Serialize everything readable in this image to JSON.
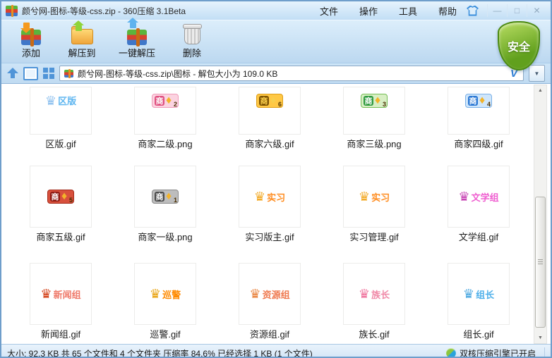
{
  "window": {
    "title": "颜兮网-图标-等级-css.zip - 360压缩 3.1Beta",
    "controls": {
      "minimize": "—",
      "maximize": "□",
      "close": "✕"
    }
  },
  "menu": {
    "items": [
      "文件",
      "操作",
      "工具",
      "帮助"
    ]
  },
  "toolbar": {
    "add_label": "添加",
    "extract_to_label": "解压到",
    "one_click_extract_label": "一键解压",
    "delete_label": "删除",
    "security_label": "安全"
  },
  "addressbar": {
    "path": "颜兮网-图标-等级-css.zip\\图标 - 解包大小为 109.0 KB",
    "v_mark": "V"
  },
  "glyphs": {
    "crown": "♛",
    "gem": "♦",
    "scroll_up": "▲",
    "scroll_down": "▼",
    "dropdown": "▼"
  },
  "files": [
    {
      "name": "区版.gif",
      "kind": "crown",
      "text": "区版",
      "crown": "#8fc1ef",
      "text_color": "#5fb6f0"
    },
    {
      "name": "商家二级.png",
      "kind": "badge",
      "char": "商",
      "level": "2",
      "char_bg": "#e05080",
      "char_color": "#ffffff",
      "outer": "#fbd3e0",
      "outer_border": "#f09ab8",
      "gem": "#f3b32a"
    },
    {
      "name": "商家六级.gif",
      "kind": "badge",
      "char": "商",
      "level": "6",
      "char_bg": "#7d5200",
      "char_color": "#ffd34d",
      "outer": "#ffc845",
      "outer_border": "#dd9d1a",
      "gem": "#f7cf4e"
    },
    {
      "name": "商家三级.png",
      "kind": "badge",
      "char": "商",
      "level": "3",
      "char_bg": "#2f9a3f",
      "char_color": "#ffffff",
      "outer": "#d8efc4",
      "outer_border": "#74bd55",
      "gem": "#f3b32a"
    },
    {
      "name": "商家四级.gif",
      "kind": "badge",
      "char": "商",
      "level": "4",
      "char_bg": "#2b78d4",
      "char_color": "#ffffff",
      "outer": "#cfe6fb",
      "outer_border": "#7bb0e6",
      "gem": "#f3b32a"
    },
    {
      "name": "商家五级.gif",
      "kind": "badge",
      "char": "商",
      "level": "5",
      "char_bg": "#8f1a12",
      "char_color": "#ffffff",
      "outer": "#d8503c",
      "outer_border": "#a32a1a",
      "gem": "#f3b32a"
    },
    {
      "name": "商家一级.png",
      "kind": "badge",
      "char": "商",
      "level": "1",
      "char_bg": "#4a4a4a",
      "char_color": "#ffffff",
      "outer": "#bdbdbd",
      "outer_border": "#8a8a8a",
      "gem": "#f3b32a"
    },
    {
      "name": "实习版主.gif",
      "kind": "crown",
      "text": "实习",
      "crown": "#f2a71f",
      "text_color": "#ff8c1f"
    },
    {
      "name": "实习管理.gif",
      "kind": "crown",
      "text": "实习",
      "crown": "#f2a71f",
      "text_color": "#ff8c1f"
    },
    {
      "name": "文学组.gif",
      "kind": "crown",
      "text": "文学组",
      "crown": "#c43bb0",
      "text_color": "#ef5fd0"
    },
    {
      "name": "新闻组.gif",
      "kind": "crown",
      "text": "新闻组",
      "crown": "#d23c12",
      "text_color": "#ef7a6a"
    },
    {
      "name": "巡警.gif",
      "kind": "crown",
      "text": "巡警",
      "crown": "#e8a10c",
      "text_color": "#ff8a00"
    },
    {
      "name": "资源组.gif",
      "kind": "crown",
      "text": "资源组",
      "crown": "#e8803a",
      "text_color": "#ef7a50"
    },
    {
      "name": "族长.gif",
      "kind": "crown",
      "text": "族长",
      "crown": "#ef6f9a",
      "text_color": "#f08aa8"
    },
    {
      "name": "组长.gif",
      "kind": "crown",
      "text": "组长",
      "crown": "#4aa7e0",
      "text_color": "#4fb0ea"
    }
  ],
  "statusbar": {
    "left": "大小: 92.3 KB 共 65 个文件和 4 个文件夹 压缩率 84.6% 已经选择 1 KB (1 个文件)",
    "engine": "双核压缩引擎已开启"
  },
  "colors": {
    "security_green": "#61a01d",
    "window_border": "#6f9ecb",
    "accent_blue": "#4f94d8"
  }
}
